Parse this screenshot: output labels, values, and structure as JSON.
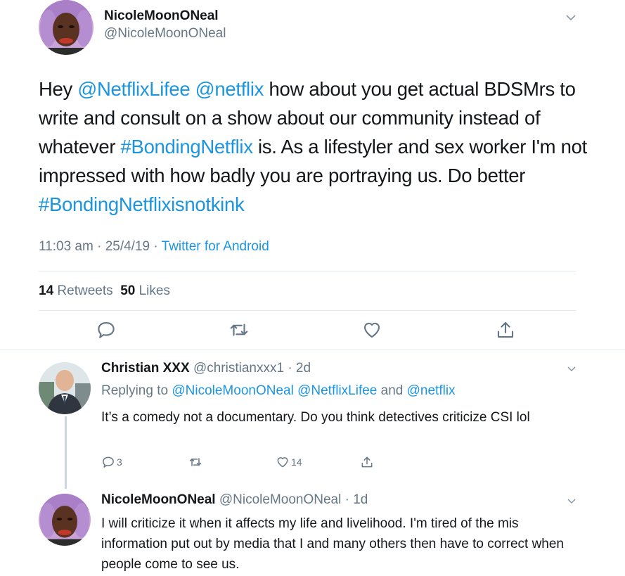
{
  "main_tweet": {
    "display_name": "NicoleMoonONeal",
    "handle": "@NicoleMoonONeal",
    "text_segments": [
      {
        "text": "Hey ",
        "link": false
      },
      {
        "text": "@NetflixLifee",
        "link": true
      },
      {
        "text": " ",
        "link": false
      },
      {
        "text": "@netflix",
        "link": true
      },
      {
        "text": " how about you get actual BDSMrs to write and consult on a show about our community instead of whatever ",
        "link": false
      },
      {
        "text": "#BondingNetflix",
        "link": true
      },
      {
        "text": " is. As a lifestyler and sex worker I'm not impressed with how badly you are portraying us. Do better ",
        "link": false
      },
      {
        "text": "#BondingNetflixisnotkink",
        "link": true
      }
    ],
    "time": "11:03 am · 25/4/19 · ",
    "source": "Twitter for Android",
    "retweets_count": "14",
    "retweets_label": "Retweets",
    "likes_count": "50",
    "likes_label": "Likes",
    "actions": [
      "reply-icon",
      "retweet-icon",
      "like-icon",
      "share-icon"
    ]
  },
  "replies": [
    {
      "display_name": "Christian XXX",
      "handle_time": "@christianxxx1 · 2d",
      "replying_prefix": "Replying to ",
      "replying_1": "@NicoleMoonONeal",
      "replying_2": "@NetflixLifee",
      "replying_and": " and ",
      "replying_3": "@netflix",
      "text": "It’s a comedy not a documentary.  Do you think detectives criticize CSI lol",
      "reply_count": "3",
      "retweet_count": "",
      "like_count": "14"
    },
    {
      "display_name": "NicoleMoonONeal",
      "handle_time": "@NicoleMoonONeal · 1d",
      "text": "I will criticize it when it affects my life and livelihood. I'm tired of the mis information put out by media that I and many others then have to correct when people come to see us."
    }
  ],
  "colors": {
    "link": "#1b95e0",
    "muted": "#657786",
    "divider": "#e1e8ed"
  }
}
